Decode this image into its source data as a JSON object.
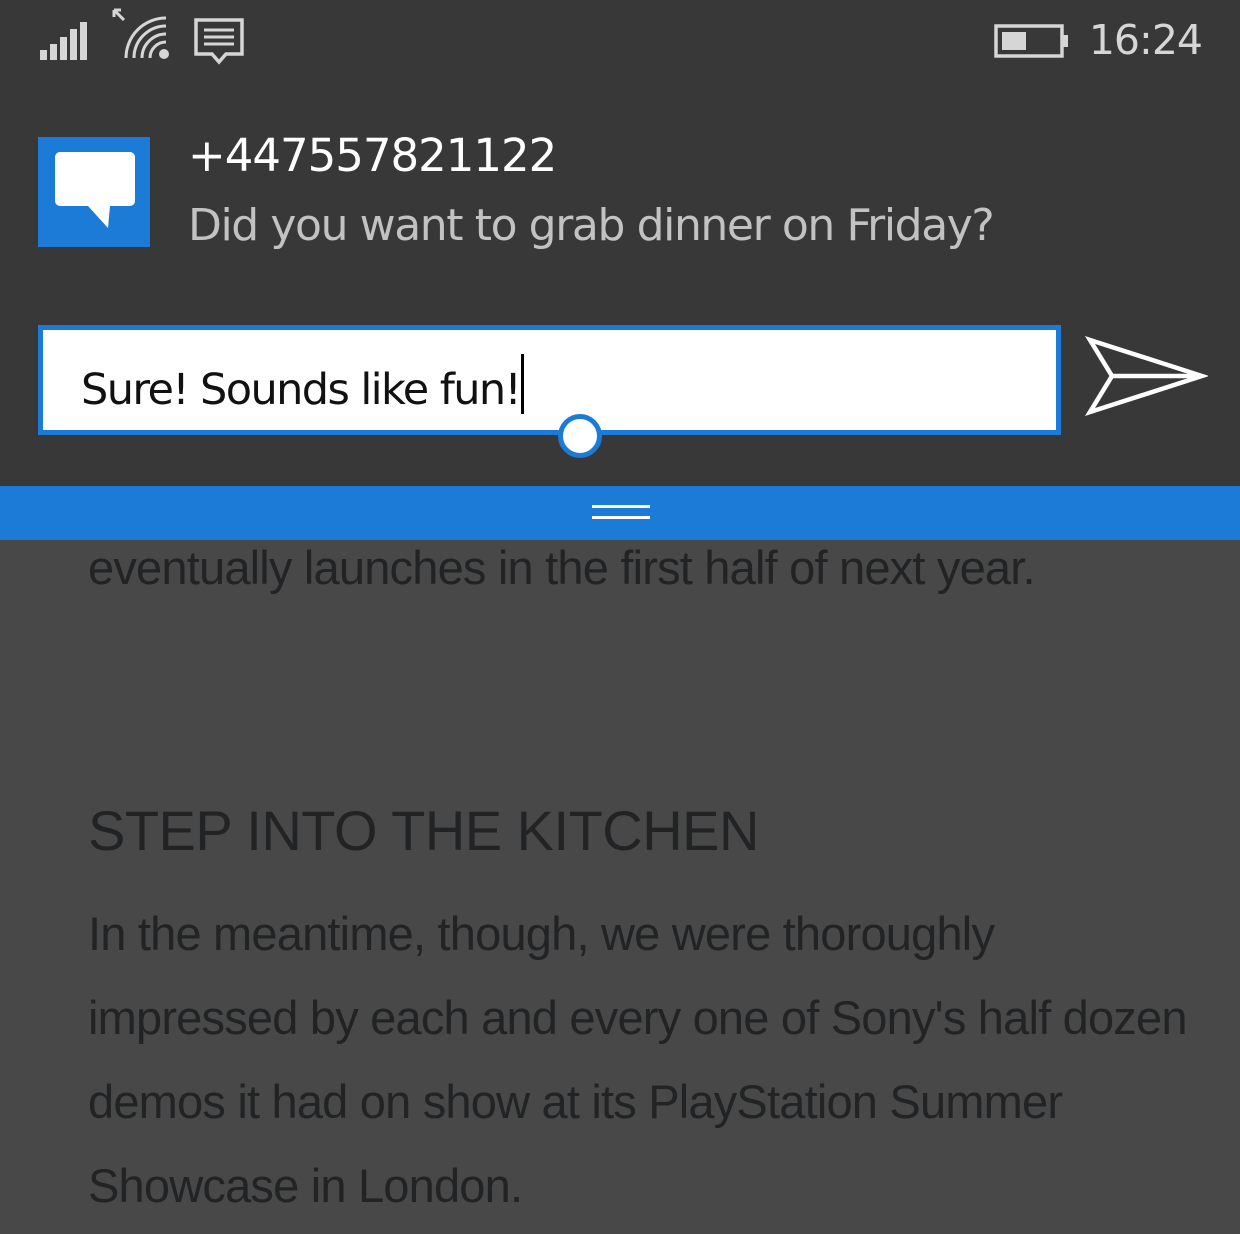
{
  "status_bar": {
    "time": "16:24",
    "icons": [
      "signal-strength-icon",
      "wifi-icon",
      "message-icon",
      "battery-icon"
    ]
  },
  "notification": {
    "app_icon": "message-bubble-icon",
    "sender": "+447557821122",
    "message": "Did you want to grab dinner on Friday?",
    "reply_value": "Sure! Sounds like fun!",
    "send_icon": "send-arrow-icon"
  },
  "article": {
    "paragraph_1": "eventually launches in the first half of next year.",
    "heading": "STEP INTO THE KITCHEN",
    "paragraph_2": "In the meantime, though, we were thoroughly impressed by each and every one of Sony's half dozen demos it had on show at its PlayStation Summer Showcase in London."
  },
  "colors": {
    "accent": "#1b7bd6",
    "toast_background": "#383838",
    "page_background": "#484848"
  }
}
